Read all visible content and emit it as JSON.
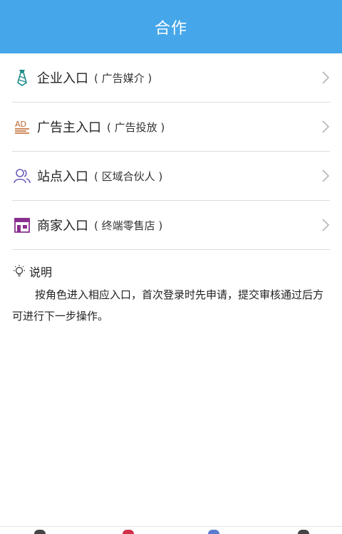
{
  "header": {
    "title": "合作"
  },
  "entries": [
    {
      "title": "企业入口",
      "sub": "( 广告媒介 )",
      "icon": "tie-icon"
    },
    {
      "title": "广告主入口",
      "sub": "( 广告投放 )",
      "icon": "ad-icon"
    },
    {
      "title": "站点入口",
      "sub": "( 区域合伙人 )",
      "icon": "people-icon"
    },
    {
      "title": "商家入口",
      "sub": "( 终端零售店 )",
      "icon": "store-icon"
    }
  ],
  "note": {
    "title": "说明",
    "text": "按角色进入相应入口，首次登录时先申请，提交审核通过后方可进行下一步操作。"
  },
  "colors": {
    "header_bg": "#46a6ea",
    "divider": "#dcdcdc"
  }
}
